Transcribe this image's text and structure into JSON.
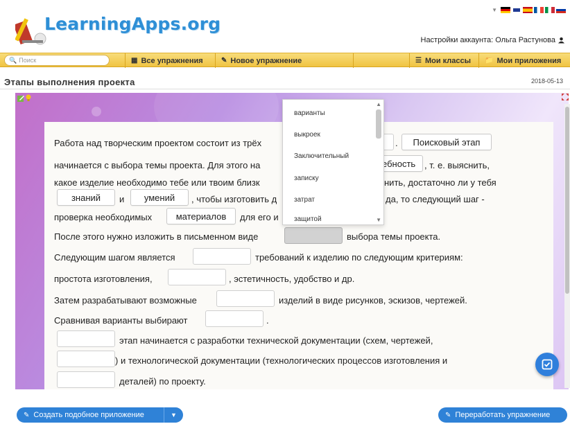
{
  "header": {
    "logo_text": "LearningApps.org",
    "account_label": "Настройки аккаунта: Ольга Растунова",
    "flags": [
      "de-flag",
      "gb-flag",
      "es-flag",
      "fr-flag",
      "it-flag",
      "ru-flag"
    ]
  },
  "navbar": {
    "search_placeholder": "Поиск",
    "items": [
      {
        "label": "Все упражнения",
        "icon": "grid-icon"
      },
      {
        "label": "Новое упражнение",
        "icon": "pencil-icon"
      },
      {
        "label": "Мои классы",
        "icon": "list-icon"
      },
      {
        "label": "Мои приложения",
        "icon": "folder-icon"
      }
    ]
  },
  "page": {
    "title": "Этапы выполнения проекта",
    "date": "2018-05-13"
  },
  "exercise": {
    "lines": [
      "Работа над творческим проектом состоит из трёх",
      "начинается с выбора темы проекта. Для этого на",
      "какое изделие необходимо тебе или твоим близк",
      ", чтобы изготовить д",
      "проверка необходимых",
      "для его и",
      "После этого нужно изложить в письменном виде",
      "выбора темы проекта.",
      "Следующим шагом является",
      "требований к изделию по следующим критериям:",
      "простота изготовления,",
      ", эстетичность, удобство и др.",
      "Затем разрабатывают возможные",
      "изделий в виде рисунков, эскизов, чертежей.",
      "Сравнивая варианты выбирают",
      ".",
      "этап начинается с разработки технической документации (схем, чертежей,",
      ") и технологической документации (технологических процессов изготовления и",
      "деталей) по проекту."
    ],
    "fragments": {
      "dot1": ".",
      "comma_te": ", т. е. выяснить,",
      "nit": "нить, достаточно ли у тебя",
      "i": "и",
      "da": "да, то следующий шаг -"
    },
    "tokens": {
      "poiskovyi": "Поисковый этап",
      "potrebnost": "ебность",
      "znaniy": "знаний",
      "umeniy": "умений",
      "materialov": "материалов"
    }
  },
  "dropdown": {
    "options": [
      "варианты",
      "выкроек",
      "Заключительный",
      "записку",
      "затрат",
      "защитой"
    ]
  },
  "footer": {
    "create_label": "Создать подобное приложение",
    "rework_label": "Переработать упражнение"
  }
}
